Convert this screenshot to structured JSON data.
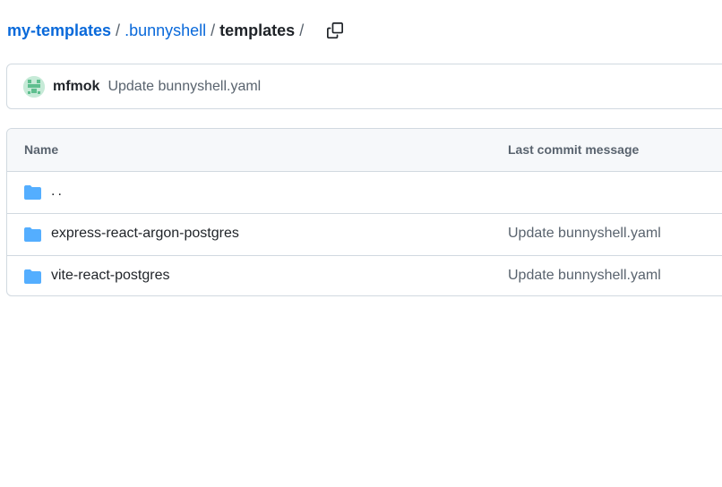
{
  "breadcrumb": {
    "repo": "my-templates",
    "folder": ".bunnyshell",
    "current": "templates",
    "separator": "/",
    "copy_icon": "copy-icon"
  },
  "latest_commit": {
    "author": "mfmok",
    "message": "Update bunnyshell.yaml"
  },
  "file_table": {
    "headers": {
      "name": "Name",
      "last_commit_message": "Last commit message"
    },
    "rows": [
      {
        "name": "..",
        "type": "parent",
        "icon": "folder-icon",
        "commit_message": ""
      },
      {
        "name": "express-react-argon-postgres",
        "type": "folder",
        "icon": "folder-icon",
        "commit_message": "Update bunnyshell.yaml"
      },
      {
        "name": "vite-react-postgres",
        "type": "folder",
        "icon": "folder-icon",
        "commit_message": "Update bunnyshell.yaml"
      }
    ]
  },
  "colors": {
    "link": "#0969da",
    "folder": "#54aeff",
    "muted_text": "#59636e",
    "border": "#d1d9e0",
    "header_bg": "#f6f8fa"
  }
}
